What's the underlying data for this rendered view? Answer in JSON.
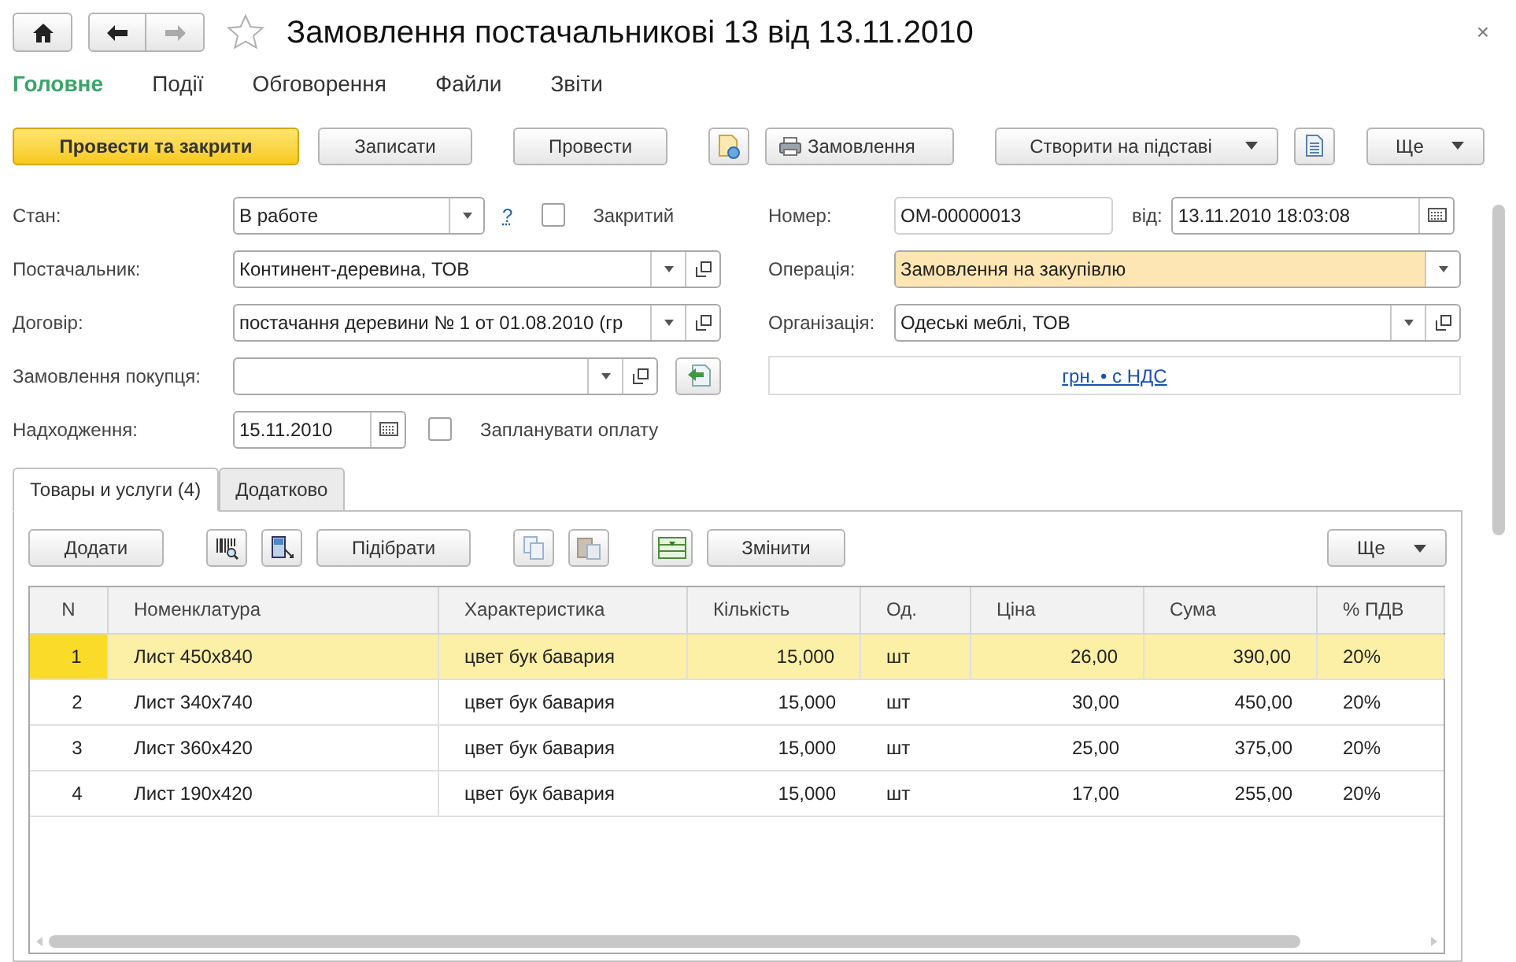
{
  "window": {
    "title": "Замовлення постачальникові 13 від 13.11.2010",
    "close": "×"
  },
  "nav_tabs": [
    {
      "label": "Головне",
      "selected": true
    },
    {
      "label": "Події",
      "selected": false
    },
    {
      "label": "Обговорення",
      "selected": false
    },
    {
      "label": "Файли",
      "selected": false
    },
    {
      "label": "Звіти",
      "selected": false
    }
  ],
  "toolbar": [
    {
      "kind": "primary",
      "label": "Провести та закрити"
    },
    {
      "kind": "button",
      "label": "Записати"
    },
    {
      "kind": "button",
      "label": "Провести"
    },
    {
      "kind": "icon"
    },
    {
      "kind": "print",
      "label": "Замовлення"
    },
    {
      "kind": "dropdown",
      "label": "Створити на підставі"
    },
    {
      "kind": "icon"
    },
    {
      "kind": "dropdown",
      "label": "Ще"
    }
  ],
  "form_left": [
    {
      "kind": "select",
      "label": "Стан:",
      "value": "В работе",
      "help": "?",
      "checkbox": {
        "label": "Закритий",
        "checked": false
      }
    },
    {
      "kind": "ref",
      "label": "Постачальник:",
      "value": "Континент-деревина, ТОВ"
    },
    {
      "kind": "ref",
      "label": "Договір:",
      "value": "постачання деревини № 1 от 01.08.2010 (гр"
    },
    {
      "kind": "ref-extra",
      "label": "Замовлення покупця:"
    },
    {
      "kind": "date",
      "label": "Надходження:",
      "value": "15.11.2010",
      "checkbox": {
        "label": "Запланувати оплату",
        "checked": false
      }
    }
  ],
  "form_right": [
    {
      "kind": "number",
      "label": "Номер:",
      "value": "ОМ-00000013",
      "date_label": "від:",
      "date_value": "13.11.2010 18:03:08"
    },
    {
      "kind": "select-highlight",
      "label": "Операція:",
      "value": "Замовлення на закупівлю"
    },
    {
      "kind": "ref",
      "label": "Організація:",
      "value": "Одеські меблі, ТОВ"
    },
    {
      "kind": "link",
      "value": "грн. • с НДС"
    }
  ],
  "tabs": [
    {
      "label": "Товары и услуги (4)",
      "selected": true
    },
    {
      "label": "Додатково",
      "selected": false
    }
  ],
  "table_toolbar": [
    {
      "kind": "button",
      "label": "Додати"
    },
    {
      "kind": "icon"
    },
    {
      "kind": "icon"
    },
    {
      "kind": "button",
      "label": "Підібрати"
    },
    {
      "kind": "icon"
    },
    {
      "kind": "icon"
    },
    {
      "kind": "icon"
    },
    {
      "kind": "button",
      "label": "Змінити"
    },
    {
      "kind": "dropdown",
      "label": "Ще"
    }
  ],
  "table": {
    "columns": [
      "N",
      "Номенклатура",
      "Характеристика",
      "Кількість",
      "Од.",
      "Ціна",
      "Сума",
      "% ПДВ"
    ],
    "rows": [
      {
        "selected": true,
        "cells": [
          "1",
          "Лист 450x840",
          "цвет бук бавария",
          "15,000",
          "шт",
          "26,00",
          "390,00",
          "20%"
        ]
      },
      {
        "selected": false,
        "cells": [
          "2",
          "Лист 340x740",
          "цвет бук бавария",
          "15,000",
          "шт",
          "30,00",
          "450,00",
          "20%"
        ]
      },
      {
        "selected": false,
        "cells": [
          "3",
          "Лист 360x420",
          "цвет бук бавария",
          "15,000",
          "шт",
          "25,00",
          "375,00",
          "20%"
        ]
      },
      {
        "selected": false,
        "cells": [
          "4",
          "Лист 190x420",
          "цвет бук бавария",
          "15,000",
          "шт",
          "17,00",
          "255,00",
          "20%"
        ]
      }
    ]
  }
}
